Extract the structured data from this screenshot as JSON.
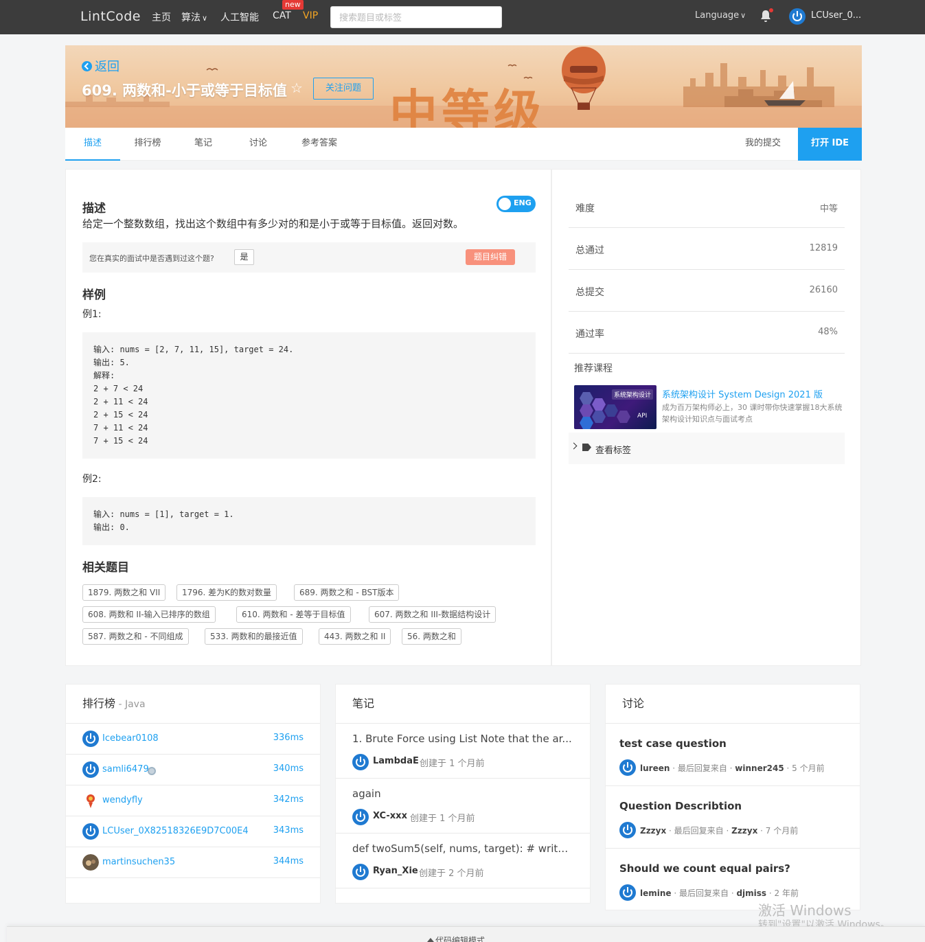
{
  "nav": {
    "logo": "LintCode",
    "items": [
      "主页",
      "算法",
      "人工智能",
      "CAT",
      "VIP"
    ],
    "new_badge": "new",
    "search_placeholder": "搜索题目或标签",
    "language": "Language",
    "user": "LCUser_0..."
  },
  "banner": {
    "back": "返回",
    "title": "609. 两数和-小于或等于目标值",
    "follow": "关注问题",
    "level": "中等级"
  },
  "tabs": {
    "items": [
      "描述",
      "排行榜",
      "笔记",
      "讨论",
      "参考答案"
    ],
    "active": "描述",
    "my_submissions": "我的提交",
    "open_ide": "打开 IDE"
  },
  "description": {
    "heading": "描述",
    "lang_toggle": "ENG",
    "text": "给定一个整数数组，找出这个数组中有多少对的和是小于或等于目标值。返回对数。",
    "interview_question": "您在真实的面试中是否遇到过这个题?",
    "yes": "是",
    "report": "题目纠错",
    "examples_heading": "样例",
    "examples": [
      {
        "label": "例1:",
        "code": "输入: nums = [2, 7, 11, 15], target = 24.\n输出: 5.\n解释:\n2 + 7 < 24\n2 + 11 < 24\n2 + 15 < 24\n7 + 11 < 24\n7 + 15 < 24"
      },
      {
        "label": "例2:",
        "code": "输入: nums = [1], target = 1.\n输出: 0."
      }
    ],
    "related_heading": "相关题目",
    "related": [
      "1879. 两数之和 VII",
      "1796. 差为K的数对数量",
      "689. 两数之和 - BST版本",
      "608. 两数和 II-输入已排序的数组",
      "610. 两数和 - 差等于目标值",
      "607. 两数之和 III-数据结构设计",
      "587. 两数之和 - 不同组成",
      "533. 两数和的最接近值",
      "443. 两数之和 II",
      "56. 两数之和"
    ]
  },
  "stats": {
    "rows": [
      {
        "k": "难度",
        "v": "中等"
      },
      {
        "k": "总通过",
        "v": "12819"
      },
      {
        "k": "总提交",
        "v": "26160"
      },
      {
        "k": "通过率",
        "v": "48%"
      }
    ],
    "recommended": "推荐课程",
    "course_title": "系统架构设计 System Design 2021 版",
    "course_desc": "成为百万架构师必上，30 课时带你快速掌握18大系统架构设计知识点与面试考点",
    "course_badge": "系统架构设计",
    "course_api": "API",
    "view_tags": "查看标签"
  },
  "leaderboard": {
    "title": "排行榜",
    "sub": " - Java",
    "rows": [
      {
        "name": "Icebear0108",
        "ms": "336ms"
      },
      {
        "name": "samli6479",
        "ms": "340ms"
      },
      {
        "name": "wendyfly",
        "ms": "342ms"
      },
      {
        "name": "LCUser_0X82518326E9D7C00E4",
        "ms": "343ms"
      },
      {
        "name": "martinsuchen35",
        "ms": "344ms"
      }
    ]
  },
  "notes": {
    "title": "笔记",
    "rows": [
      {
        "t": "1. Brute Force using List Note that the ar...",
        "who": "LambdaE",
        "when": "创建于 1 个月前"
      },
      {
        "t": "again",
        "who": "XC-xxx",
        "when": "创建于 1 个月前"
      },
      {
        "t": "def twoSum5(self, nums, target): # write ...",
        "who": "Ryan_Xie",
        "when": "创建于 2 个月前"
      }
    ]
  },
  "discuss": {
    "title": "讨论",
    "rows": [
      {
        "t": "test case question",
        "who": "lureen",
        "mid": " · 最后回复来自 · ",
        "last": "winner245",
        "when": " · 5 个月前"
      },
      {
        "t": "Question Describtion",
        "who": "Zzzyx",
        "mid": " · 最后回复来自 · ",
        "last": "Zzzyx",
        "when": " · 7 个月前"
      },
      {
        "t": "Should we count equal pairs?",
        "who": "lemine",
        "mid": " · 最后回复来自 · ",
        "last": "djmiss",
        "when": " · 2 年前"
      }
    ]
  },
  "watermark": {
    "line1": "激活 Windows",
    "line2": "转到\"设置\"以激活 Windows。"
  },
  "editor_mode": "代码编辑模式"
}
